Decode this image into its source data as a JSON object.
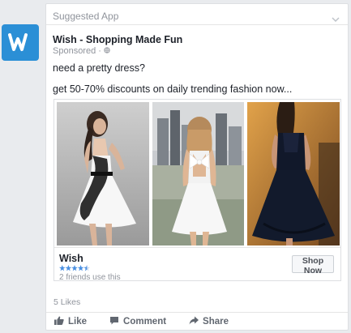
{
  "header": {
    "title": "Suggested App"
  },
  "post": {
    "title": "Wish - Shopping Made Fun",
    "sponsored": "Sponsored",
    "sponsored_sep": "·",
    "text_1": "need a pretty dress?",
    "text_2": "get 50-70% discounts on daily trending fashion now..."
  },
  "carousel": {
    "images": [
      "white-dress-lace-photo",
      "white-bow-back-dress-photo",
      "black-dress-photo"
    ],
    "app_name": "Wish",
    "rating_stars": 4.5,
    "social": "2 friends use this",
    "cta": "Shop Now"
  },
  "engagement": {
    "likes": "5 Likes"
  },
  "actions": {
    "like": "Like",
    "comment": "Comment",
    "share": "Share"
  },
  "colors": {
    "brand": "#2b8fd6",
    "star": "#4a90e2",
    "text": "#1d2129",
    "muted": "#90949c"
  }
}
